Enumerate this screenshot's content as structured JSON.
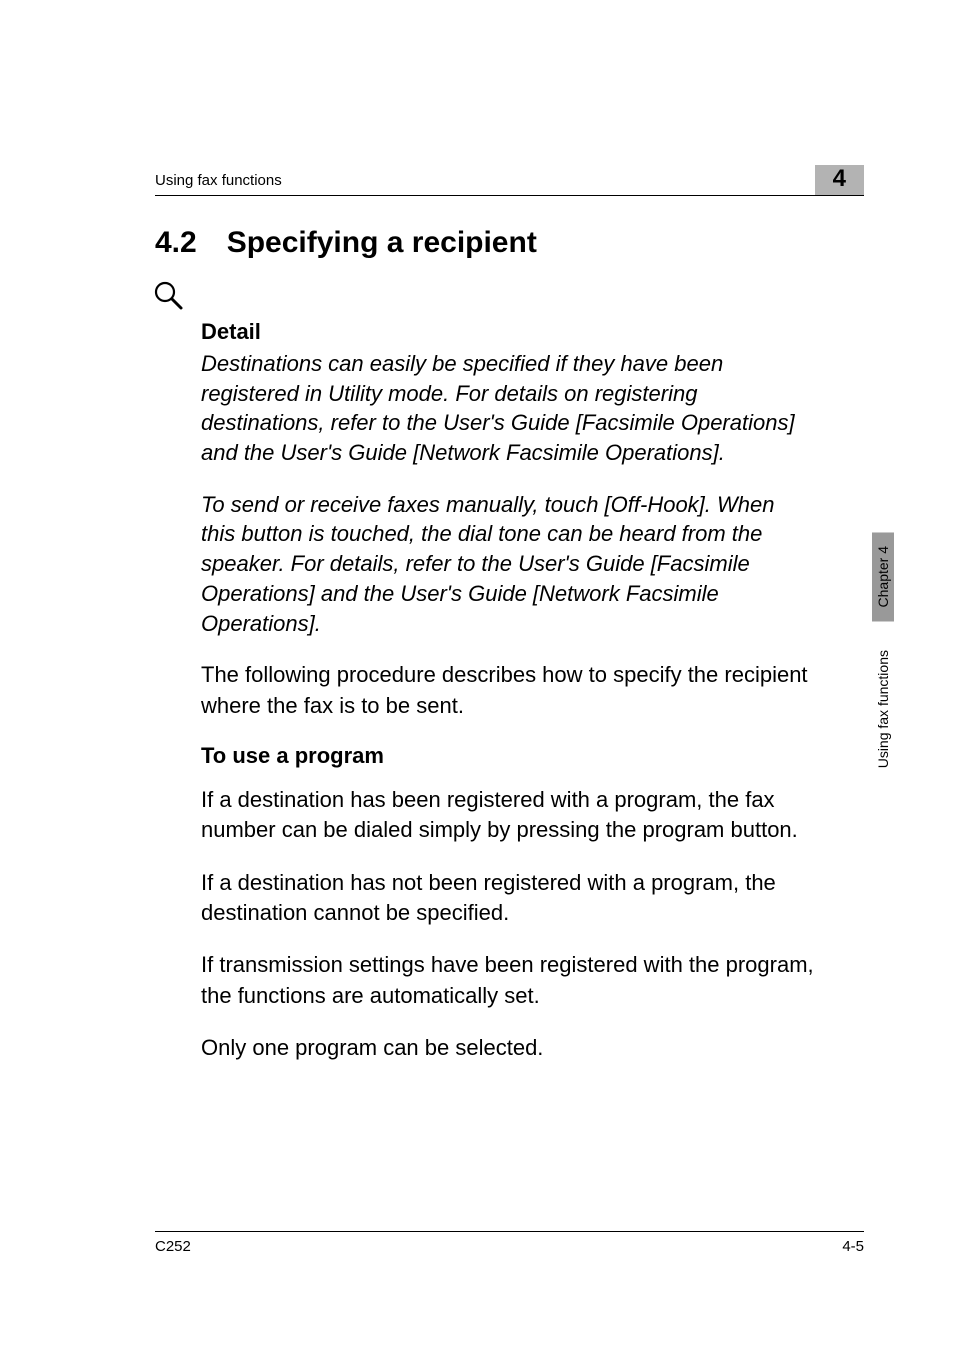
{
  "header": {
    "breadcrumb": "Using fax functions",
    "sectionNumber": "4"
  },
  "section": {
    "number": "4.2",
    "title": "Specifying a recipient"
  },
  "detail": {
    "label": "Detail",
    "para1": "Destinations can easily be specified if they have been registered in Utility mode. For details on registering destinations, refer to the User's Guide [Facsimile Operations] and the User's Guide [Network Facsimile Operations].",
    "para2": "To send or receive faxes manually, touch [Off-Hook]. When this button is touched, the dial tone can be heard from the speaker. For details, refer to the User's Guide [Facsimile Operations] and the User's Guide [Network Facsimile Operations]."
  },
  "intro": "The following procedure describes how to specify the recipient where the fax is to be sent.",
  "subsection": {
    "title": "To use a program",
    "p1": "If a destination has been registered with a program, the fax number can be dialed simply by pressing the program button.",
    "p2": "If a destination has not been registered with a program, the destination cannot be specified.",
    "p3": "If transmission settings have been registered with the program, the functions are automatically set.",
    "p4": "Only one program can be selected."
  },
  "sideTab": "Chapter 4",
  "sideLabel": "Using fax functions",
  "footer": {
    "left": "C252",
    "right": "4-5"
  }
}
